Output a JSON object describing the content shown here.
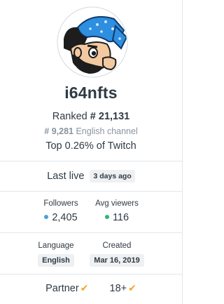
{
  "channel": {
    "name": "i64nfts"
  },
  "ranking": {
    "ranked_prefix": "Ranked",
    "ranked_value": "# 21,131",
    "channel_rank_value": "# 9,281",
    "channel_rank_suffix": "English channel",
    "top_text": "Top 0.26% of Twitch"
  },
  "last_live": {
    "label": "Last live",
    "value": "3 days ago"
  },
  "stats": {
    "followers_label": "Followers",
    "followers_value": "2,405",
    "followers_color": "#4a9fd8",
    "avg_viewers_label": "Avg viewers",
    "avg_viewers_value": "116",
    "avg_viewers_color": "#2bb673"
  },
  "meta": {
    "language_label": "Language",
    "language_value": "English",
    "created_label": "Created",
    "created_value": "Mar 16, 2019"
  },
  "badges": {
    "partner_label": "Partner",
    "mature_label": "18+",
    "check_color": "#f5a623"
  }
}
